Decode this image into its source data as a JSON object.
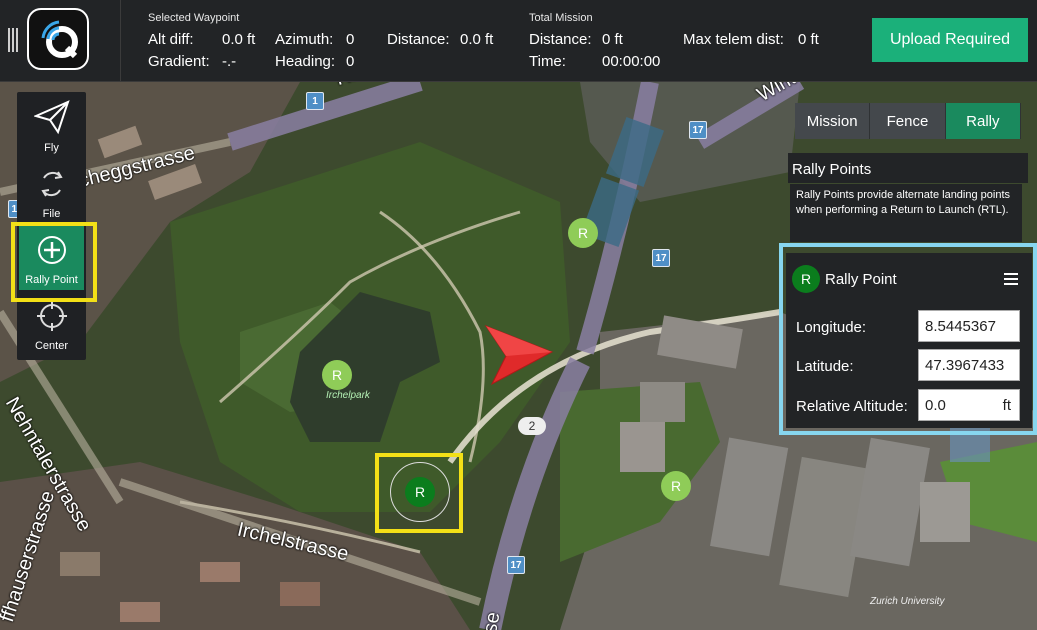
{
  "toolbar": {
    "selected_waypoint_header": "Selected Waypoint",
    "alt_diff_label": "Alt diff:",
    "alt_diff_value": "0.0 ft",
    "gradient_label": "Gradient:",
    "gradient_value": "-.-",
    "azimuth_label": "Azimuth:",
    "azimuth_value": "0",
    "heading_label": "Heading:",
    "heading_value": "0",
    "distance_label": "Distance:",
    "distance_value": "0.0 ft",
    "total_mission_header": "Total Mission",
    "total_distance_label": "Distance:",
    "total_distance_value": "0 ft",
    "time_label": "Time:",
    "time_value": "00:00:00",
    "max_telem_label": "Max telem dist:",
    "max_telem_value": "0 ft",
    "upload_button": "Upload Required"
  },
  "tools": [
    {
      "label": "Fly",
      "icon": "paper-plane-icon"
    },
    {
      "label": "File",
      "icon": "sync-icon"
    },
    {
      "label": "Rally Point",
      "icon": "plus-circle-icon",
      "active": true
    },
    {
      "label": "Center",
      "icon": "crosshair-icon"
    }
  ],
  "plan_tabs": [
    {
      "label": "Mission"
    },
    {
      "label": "Fence"
    },
    {
      "label": "Rally",
      "active": true
    }
  ],
  "rally_panel": {
    "header": "Rally Points",
    "info": "Rally Points provide alternate landing points when performing a Return to Launch (RTL)."
  },
  "rally_editor": {
    "badge": "R",
    "title": "Rally Point",
    "longitude_label": "Longitude:",
    "longitude_value": "8.5445367",
    "latitude_label": "Latitude:",
    "latitude_value": "47.3967433",
    "altitude_label": "Relative Altitude:",
    "altitude_value": "0.0",
    "altitude_unit": "ft"
  },
  "map": {
    "rally_markers": [
      "R",
      "R",
      "R",
      "R"
    ],
    "route_numbers": [
      "1",
      "17",
      "17",
      "17",
      "17"
    ],
    "road_number": "2",
    "streets": [
      "Hirsc",
      "Wint",
      "cheggstrasse",
      "Irchelstrasse",
      "Nehntalerstrasse",
      "ffhauserstrasse",
      "sse"
    ],
    "places": [
      "Irchelpark",
      "Zurich University"
    ]
  },
  "colors": {
    "accent_green": "#1bb07a",
    "active_tool": "#1a8a5e",
    "highlight_yellow": "#f3e017",
    "highlight_cyan": "#87d6ef",
    "vehicle_red": "#e02a2a"
  }
}
